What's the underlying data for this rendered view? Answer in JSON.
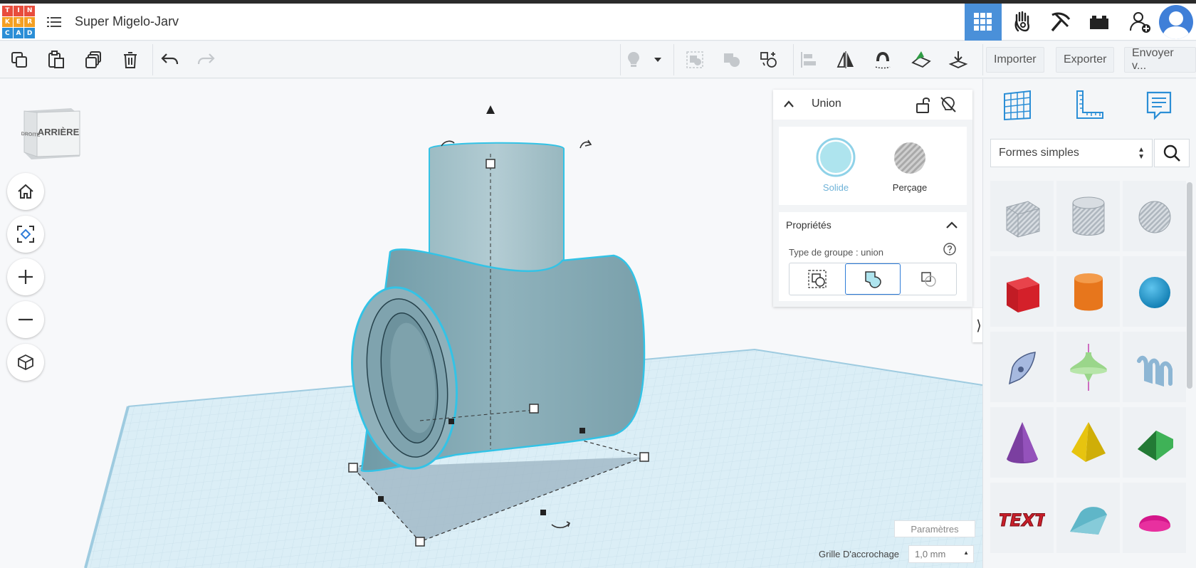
{
  "app": {
    "logo_letters": [
      "T",
      "I",
      "N",
      "K",
      "E",
      "R",
      "C",
      "A",
      "D"
    ],
    "logo_colors": [
      "#e84d3d",
      "#e84d3d",
      "#e84d3d",
      "#f4a023",
      "#f4a023",
      "#f4a023",
      "#2b8ed6",
      "#2b8ed6",
      "#2b8ed6"
    ],
    "project_title": "Super Migelo-Jarv"
  },
  "header": {
    "buttons": [
      {
        "name": "3d-design-grid",
        "icon": "grid-icon",
        "active": true
      },
      {
        "name": "blocks",
        "icon": "hand-icon",
        "active": false
      },
      {
        "name": "minecraft",
        "icon": "pickaxe-icon",
        "active": false
      },
      {
        "name": "bricks",
        "icon": "brick-icon",
        "active": false
      },
      {
        "name": "add-user",
        "icon": "add-user-icon",
        "active": false
      }
    ],
    "accent": "#4a90d9"
  },
  "toolbar": {
    "left_actions": [
      "copy-icon",
      "paste-icon",
      "duplicate-icon",
      "trash-icon",
      "undo-icon",
      "redo-icon"
    ],
    "right_actions": [
      "lightbulb-icon",
      "dropdown-arrow-icon",
      "group-icon",
      "ungroup-icon",
      "align-icon",
      "flip-align-icon",
      "mirror-icon",
      "magnet-icon",
      "workplane-icon",
      "drop-icon"
    ],
    "import_label": "Importer",
    "export_label": "Exporter",
    "send_label": "Envoyer v..."
  },
  "viewcube": {
    "front_label": "ARRIÈRE",
    "side_label": "DROITE"
  },
  "inspector": {
    "title": "Union",
    "solid_label": "Solide",
    "hole_label": "Perçage",
    "solid_color": "#aee4ee",
    "properties_title": "Propriétés",
    "group_type_label": "Type de groupe : union"
  },
  "right_panel": {
    "category": "Formes simples",
    "shapes": [
      {
        "name": "box-hole",
        "color": "#b6bec6"
      },
      {
        "name": "cylinder-hole",
        "color": "#b6bec6"
      },
      {
        "name": "sphere-hole",
        "color": "#b6bec6"
      },
      {
        "name": "box",
        "color": "#d4202a"
      },
      {
        "name": "cylinder",
        "color": "#e7761c"
      },
      {
        "name": "sphere",
        "color": "#1a9dd6"
      },
      {
        "name": "scribble",
        "color": "#8aa5d0"
      },
      {
        "name": "paraboloid",
        "color": "#9ad68a"
      },
      {
        "name": "text-waves",
        "color": "#8db6d4"
      },
      {
        "name": "cone",
        "color": "#7b3fa0"
      },
      {
        "name": "pyramid",
        "color": "#e7c40f"
      },
      {
        "name": "roof",
        "color": "#2f9c45"
      },
      {
        "name": "text",
        "color": "#c81f2a"
      },
      {
        "name": "half-cylinder",
        "color": "#5fb6c8"
      },
      {
        "name": "half-sphere",
        "color": "#d4168a"
      }
    ]
  },
  "bottom": {
    "params_label": "Paramètres",
    "snap_label": "Grille D'accrochage",
    "snap_value": "1,0 mm"
  }
}
